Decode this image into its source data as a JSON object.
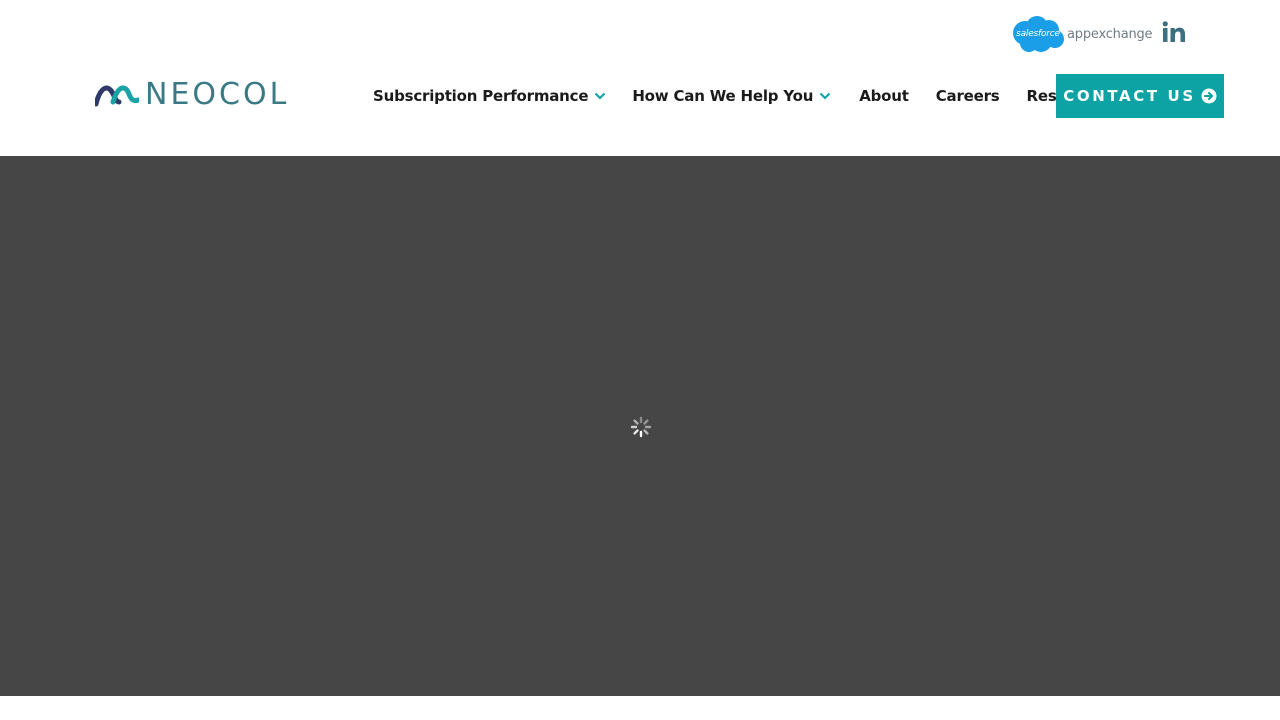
{
  "topbar": {
    "salesforce": {
      "brand": "salesforce",
      "suffix": "appexchange",
      "cloud_color": "#1b9ee8"
    },
    "linkedin_icon": "linkedin-icon"
  },
  "header": {
    "logo": {
      "text": "NEOCOL",
      "icon": "neocol-wave-logo",
      "color": "#3a7a86"
    },
    "nav": [
      {
        "label": "Subscription Performance",
        "has_dropdown": true
      },
      {
        "label": "How Can We Help You",
        "has_dropdown": true
      },
      {
        "label": "About",
        "has_dropdown": false
      },
      {
        "label": "Careers",
        "has_dropdown": false
      },
      {
        "label": "Resources",
        "has_dropdown": false
      }
    ],
    "contact_button": {
      "label": "CONTACT US",
      "icon": "arrow-circle-right-icon",
      "color": "#0da2a3"
    }
  },
  "hero": {
    "state": "loading",
    "icon": "loading-spinner-icon",
    "background": "#464646"
  },
  "colors": {
    "accent": "#0da2a3",
    "chevron": "#14a6a8",
    "text": "#1b1b1b"
  }
}
